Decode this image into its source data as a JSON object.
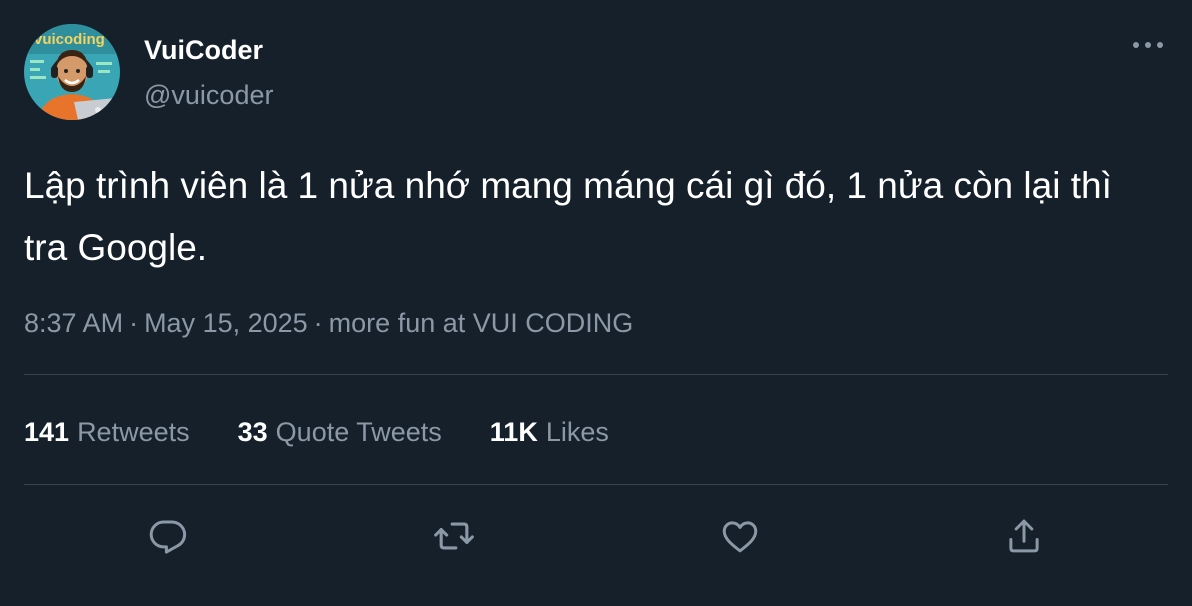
{
  "author": {
    "display_name": "VuiCoder",
    "handle": "@vuicoder",
    "avatar_icon": "coder-avatar-icon",
    "avatar_text": "vuicoding"
  },
  "more_icon": "more-horizontal-icon",
  "tweet": {
    "text": "Lập trình viên là 1 nửa nhớ mang máng cái gì đó, 1 nửa còn lại thì tra Google."
  },
  "meta": {
    "time": "8:37 AM",
    "separator": "·",
    "date": "May 15, 2025",
    "source": "more fun at VUI CODING"
  },
  "stats": {
    "retweets": {
      "count": "141",
      "label": "Retweets"
    },
    "quote_tweets": {
      "count": "33",
      "label": "Quote Tweets"
    },
    "likes": {
      "count": "11K",
      "label": "Likes"
    }
  },
  "actions": {
    "reply_icon": "reply-icon",
    "retweet_icon": "retweet-icon",
    "like_icon": "heart-icon",
    "share_icon": "share-icon"
  },
  "colors": {
    "background": "#15202b",
    "primary_text": "#ffffff",
    "secondary_text": "#8b98a5",
    "divider": "#38444d",
    "avatar_bg": "#3aa6b5",
    "avatar_shirt": "#e8742c"
  }
}
